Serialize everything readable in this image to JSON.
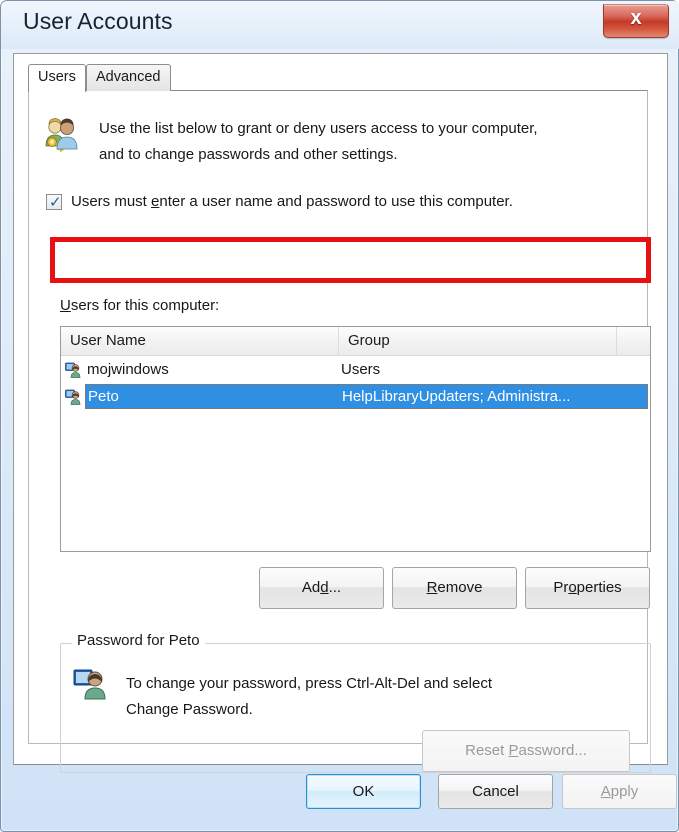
{
  "window": {
    "title": "User Accounts",
    "close_label": "x",
    "close_icon": "close-icon"
  },
  "tabs": [
    {
      "label": "Users",
      "active": true
    },
    {
      "label": "Advanced",
      "active": false
    }
  ],
  "intro": {
    "icon": "users-key-icon",
    "line1": "Use the list below to grant or deny users access to your computer,",
    "line2": "and to change passwords and other settings."
  },
  "require_password_checkbox": {
    "checked": true,
    "tick": "✓",
    "label_before": "Users must ",
    "label_accesskey": "e",
    "label_after": "nter a user name and password to use this computer."
  },
  "annotation": {
    "color": "#e81010",
    "target": "require-password-checkbox"
  },
  "user_list": {
    "label_accesskey": "U",
    "label_after": "sers for this computer:",
    "columns": [
      "User Name",
      "Group",
      ""
    ],
    "rows": [
      {
        "icon": "user-icon",
        "user_name": "mojwindows",
        "group": "Users",
        "selected": false
      },
      {
        "icon": "user-icon",
        "user_name": "Peto",
        "group": "HelpLibraryUpdaters; Administra...",
        "selected": true
      }
    ]
  },
  "actions": {
    "add": {
      "before": "Ad",
      "accesskey": "d",
      "after": "...",
      "disabled": false
    },
    "remove": {
      "before": "",
      "accesskey": "R",
      "after": "emove",
      "disabled": false
    },
    "properties": {
      "before": "Pr",
      "accesskey": "o",
      "after": "perties",
      "disabled": false
    }
  },
  "password_group": {
    "title": "Password for Peto",
    "icon": "user-monitor-icon",
    "line1": "To change your password, press Ctrl-Alt-Del and select",
    "line2": "Change Password.",
    "reset_button": {
      "before": "Reset ",
      "accesskey": "P",
      "after": "assword...",
      "disabled": true
    }
  },
  "footer": {
    "ok": {
      "label": "OK",
      "default": true,
      "disabled": false
    },
    "cancel": {
      "label": "Cancel",
      "default": false,
      "disabled": false
    },
    "apply": {
      "before": "",
      "accesskey": "A",
      "after": "pply",
      "disabled": true
    }
  },
  "colors": {
    "selection": "#2f8fe3",
    "annotation": "#e81010",
    "title_text": "#16232e",
    "close_button": "#c43a28"
  }
}
